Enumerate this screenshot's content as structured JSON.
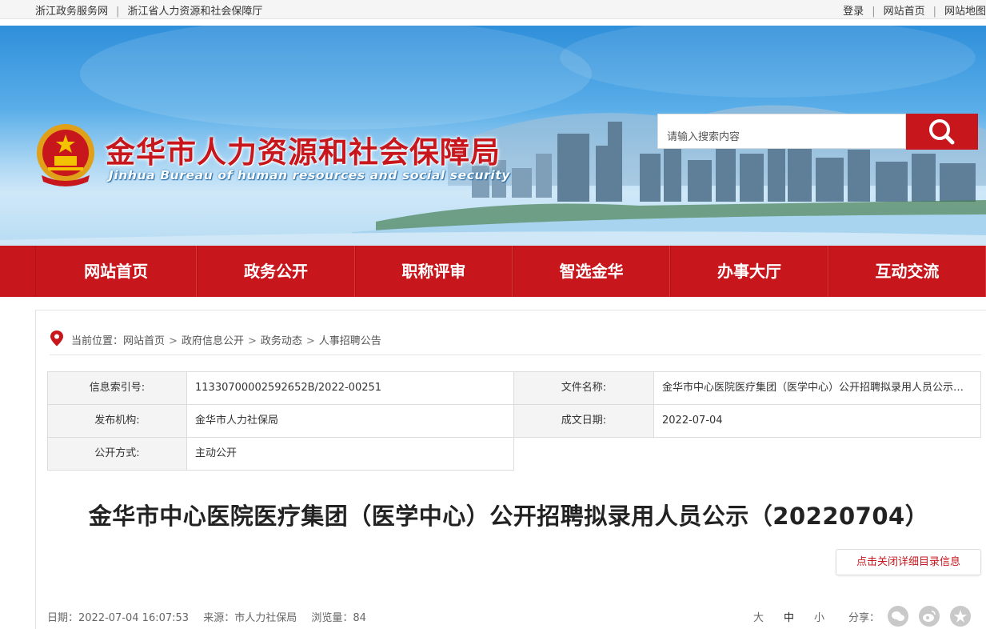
{
  "topbar": {
    "left_links": [
      "浙江政务服务网",
      "浙江省人力资源和社会保障厅"
    ],
    "right_links": [
      "登录",
      "网站首页",
      "网站地图"
    ]
  },
  "header": {
    "title": "金华市人力资源和社会保障局",
    "subtitle": "Jinhua Bureau of human resources and social security",
    "search_placeholder": "请输入搜索内容"
  },
  "nav": {
    "items": [
      "网站首页",
      "政务公开",
      "职称评审",
      "智选金华",
      "办事大厅",
      "互动交流"
    ]
  },
  "breadcrumb": {
    "prefix": "当前位置：",
    "items": [
      "网站首页",
      "政府信息公开",
      "政务动态",
      "人事招聘公告"
    ]
  },
  "info": {
    "index_label": "信息索引号:",
    "index_value": "11330700002592652B/2022-00251",
    "filename_label": "文件名称:",
    "filename_value": "金华市中心医院医疗集团（医学中心）公开招聘拟录用人员公示（20220704）",
    "publisher_label": "发布机构:",
    "publisher_value": "金华市人力社保局",
    "date_label": "成文日期:",
    "date_value": "2022-07-04",
    "mode_label": "公开方式:",
    "mode_value": "主动公开"
  },
  "article": {
    "title": "金华市中心医院医疗集团（医学中心）公开招聘拟录用人员公示（20220704）",
    "toggle_label": "点击关闭详细目录信息",
    "date": "日期：2022-07-04 16:07:53",
    "source": "来源：市人力社保局",
    "views": "浏览量：84",
    "font_sizes": [
      "大",
      "中",
      "小"
    ],
    "share_label": "分享："
  },
  "colors": {
    "brand_red": "#c8161d",
    "link_gray": "#333333"
  },
  "icons": [
    "location-pin-icon",
    "search-icon",
    "wechat-icon",
    "weibo-icon",
    "star-icon"
  ]
}
